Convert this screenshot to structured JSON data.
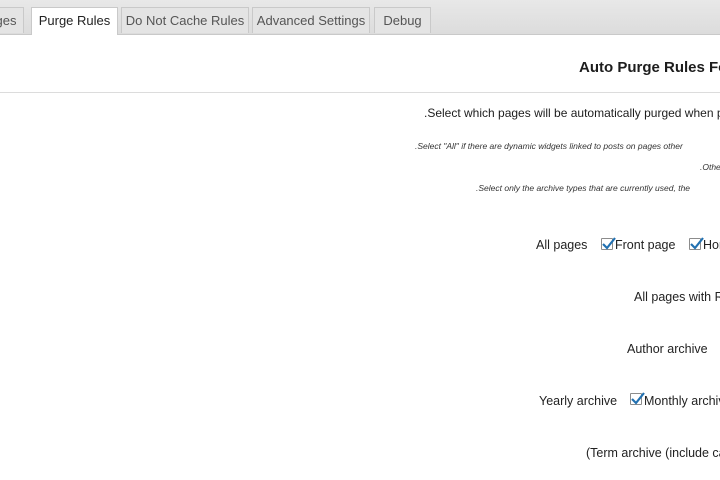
{
  "tabs": [
    {
      "label": "ges",
      "active": false
    },
    {
      "label": "Purge Rules",
      "active": true
    },
    {
      "label": "Do Not Cache Rules",
      "active": false
    },
    {
      "label": "Advanced Settings",
      "active": false
    },
    {
      "label": "Debug",
      "active": false
    }
  ],
  "section": {
    "title": "Auto Purge Rules Fo",
    "description": ".Select which pages will be automatically purged when pos",
    "notes": [
      ".Select \"All\" if there are dynamic widgets linked to posts on pages other",
      ".Othe",
      ".Select only the archive types that are currently used, the"
    ]
  },
  "options": {
    "all_pages": "All pages",
    "front_page": {
      "label": "Front page",
      "checked": true
    },
    "home": {
      "label": "Hor",
      "checked": true
    },
    "all_pages_with_r": "All pages with R",
    "author_archive": "Author archive",
    "yearly_archive": "Yearly archive",
    "monthly_archive": {
      "label": "Monthly archiv",
      "checked": true
    },
    "term_archive": "(Term archive (include ca"
  },
  "colors": {
    "checkmark": "#2271b1",
    "tabbar": "#e0e0e0"
  }
}
